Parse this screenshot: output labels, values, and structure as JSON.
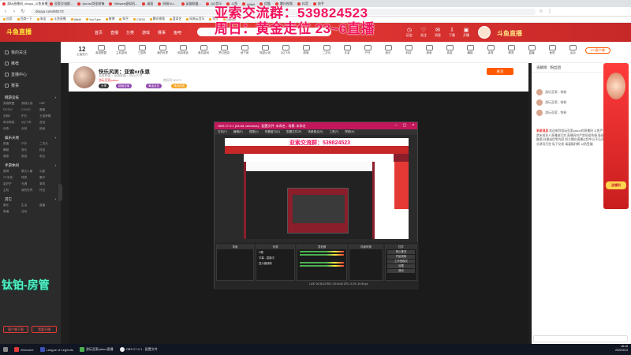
{
  "browser": {
    "tabs": [
      "游玩直播间_douyu_斗鱼直播",
      "亚索交流群...",
      "Aurora剑圣前锋",
      "VMware虚拟机...",
      "桌面",
      "网易UU...",
      "英雄联盟...",
      "QQ音乐",
      "斗鱼",
      "bilibili",
      "优酷",
      "腾讯视频",
      "抖音",
      "快手"
    ],
    "url": "douyu.com/60172",
    "bookmarks": [
      "应用",
      "百度一下",
      "淘宝",
      "斗鱼直播",
      "bilibili",
      "YouTube",
      "微博",
      "知乎",
      "CSDN",
      "腾讯视频",
      "爱奇艺",
      "网易云音乐",
      "京东",
      "GitHub"
    ]
  },
  "overlay": {
    "line1": "亚索交流群：539824523",
    "line2": "周日：黄金走位 23~6直播"
  },
  "header": {
    "logo": "斗鱼直播",
    "nav": [
      "首页",
      "直播",
      "分类",
      "游戏",
      "赛事",
      "鱼吧"
    ],
    "icons": [
      "历史",
      "关注",
      "消息",
      "下载",
      "开播"
    ]
  },
  "sidebar": {
    "main_items": [
      "我的关注",
      "推荐",
      "直播中心",
      "赛事"
    ],
    "section1_title": "网游竞技",
    "section1_items": [
      "英雄联盟",
      "穿越火线",
      "DNF",
      "DOTA2",
      "CS:GO",
      "魔兽",
      "剑网3",
      "炉石",
      "王者荣耀",
      "和平精英",
      "QQ飞车",
      "逆战",
      "传奇",
      "永劫",
      "绝地"
    ],
    "section2_title": "娱乐天地",
    "section2_items": [
      "颜值",
      "户外",
      "二次元",
      "舞蹈",
      "音乐",
      "科技",
      "美食",
      "旅游",
      "电台"
    ],
    "section3_title": "手游休闲",
    "section3_items": [
      "原神",
      "第五人格",
      "火影",
      "CF手游",
      "球球",
      "蛋仔",
      "金铲铲",
      "光遇",
      "单机",
      "主机",
      "我的世界",
      "怀旧"
    ],
    "section4_title": "其它",
    "section4_items": [
      "娱乐",
      "生活",
      "直播",
      "鱼塘",
      "活动"
    ],
    "btn1": "客户端下载",
    "btn2": "我要开播"
  },
  "watermark": "钛铂-房管",
  "categories": {
    "count": "12",
    "count_label": "主播签约",
    "items": [
      "英雄联盟",
      "主机游戏",
      "三国杀",
      "我的世界",
      "网游竞技",
      "单机游戏",
      "梦幻西游",
      "地下城",
      "穿越火线",
      "QQ飞车",
      "颜值",
      "二次元",
      "手游",
      "户外",
      "音乐",
      "科技",
      "美食",
      "旅游",
      "舞蹈",
      "体育",
      "教育",
      "直播",
      "鱼吧",
      "活动"
    ],
    "pc_button": "PC客户端"
  },
  "room": {
    "title": "快乐风男：亚索or永恩",
    "category": "英雄联盟 > 英雄联盟 > 钻石/大师",
    "host": "游玩亚索yasuo",
    "room_id": "房间号 60172",
    "tags": [
      "分享",
      "超级亚索",
      "黄金走位",
      "快乐风男"
    ],
    "follow": "关注"
  },
  "obs": {
    "title": "OBS 27.0.1 (64-bit, windows) - 配置文件: 未命名 - 场景: 未命名",
    "menu": [
      "文件(F)",
      "编辑(E)",
      "视图(V)",
      "停靠窗口(D)",
      "配置文件(P)",
      "场景集合(S)",
      "工具(T)",
      "帮助(H)"
    ],
    "inner_overlay": "亚索交流群：539824523",
    "docks": [
      "场景",
      "来源",
      "混音器",
      "场景转换",
      "控件"
    ],
    "sources": [
      "Ω蕾",
      "字幕 - 直播中",
      "显示器捕获"
    ],
    "controls": [
      "停止推流",
      "开始录制",
      "工作室模式",
      "设置",
      "退出"
    ],
    "statusbar": "LIVE: 00:35:12  REC: 00:00:00  CPU: 3.2%, 30.00 fps"
  },
  "right": {
    "tabs": [
      "贡献榜",
      "粉丝团"
    ],
    "ranks": [
      "游玩亚索 - 铁粉",
      "游玩亚索 - 铁粉",
      "游玩亚索 - 铁粉"
    ],
    "notice_title": "系统消息",
    "notice": "欢迎来到游玩亚索yasuo的直播间 斗鱼严禁未成年人直播或打赏 直播间内严禁低俗色情 吸烟酗酒 封建迷信等内容 如主播在直播过程中以不当方式诱导打赏 私下交易 请谨慎判断 以防受骗",
    "promo": "送福利"
  },
  "taskbar": {
    "items": [
      "Welcome",
      "League of Legends",
      "游玩亚索yasuo直播",
      "OBS 27.0.1 - 配置文件"
    ],
    "time": "18:18",
    "date": "2022/3/14"
  }
}
